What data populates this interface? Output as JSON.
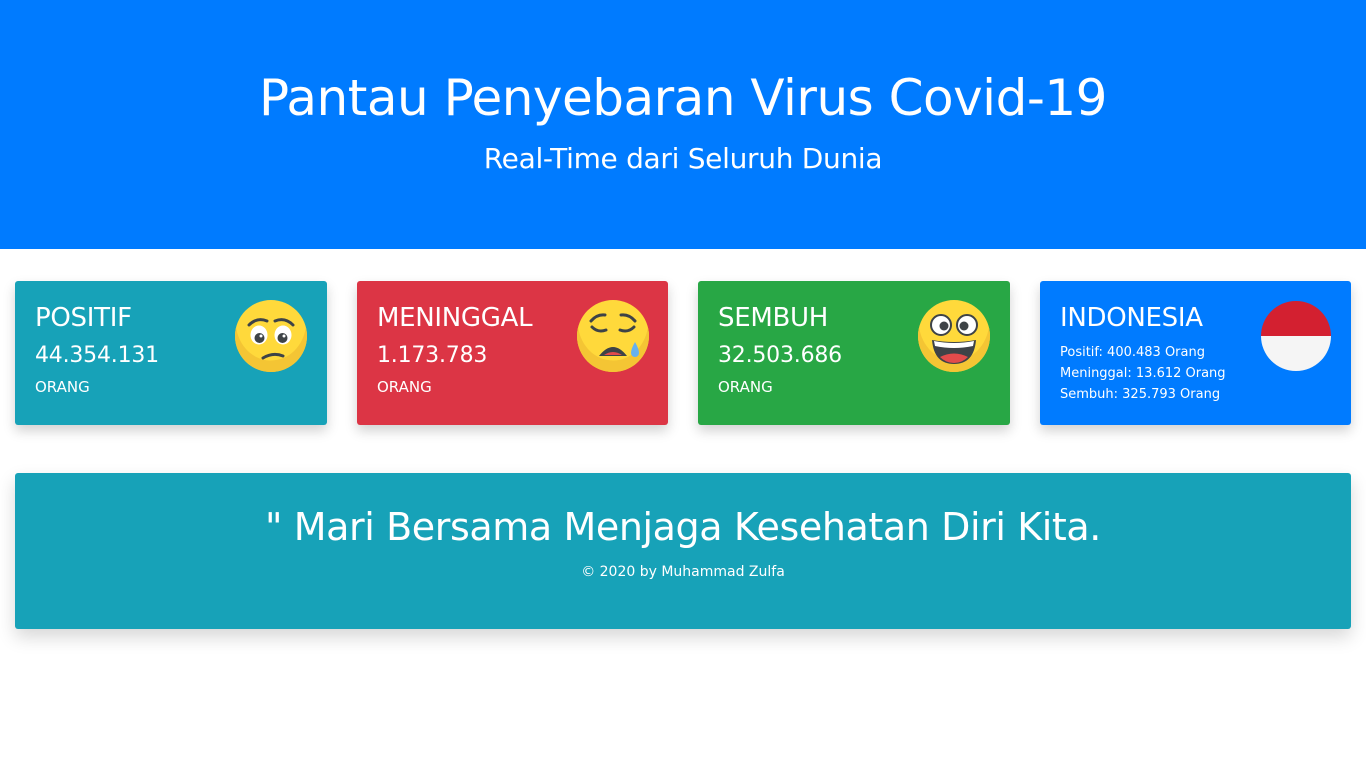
{
  "header": {
    "title": "Pantau Penyebaran Virus Covid-19",
    "subtitle": "Real-Time dari Seluruh Dunia",
    "background_color": "#007bff"
  },
  "cards": [
    {
      "title": "POSITIF",
      "value": "44.354.131",
      "unit": "ORANG",
      "icon": "worried-face-icon",
      "color": "#17a2b8"
    },
    {
      "title": "MENINGGAL",
      "value": "1.173.783",
      "unit": "ORANG",
      "icon": "crying-face-icon",
      "color": "#dc3545"
    },
    {
      "title": "SEMBUH",
      "value": "32.503.686",
      "unit": "ORANG",
      "icon": "grinning-face-icon",
      "color": "#28a745"
    },
    {
      "title": "INDONESIA",
      "lines": [
        "Positif: 400.483 Orang",
        "Meninggal: 13.612 Orang",
        "Sembuh: 325.793 Orang"
      ],
      "icon": "indonesia-flag-icon",
      "color": "#007bff"
    }
  ],
  "footer": {
    "quote": "\" Mari Bersama Menjaga Kesehatan Diri Kita.",
    "credit": "© 2020 by Muhammad Zulfa",
    "color": "#17a2b8"
  }
}
